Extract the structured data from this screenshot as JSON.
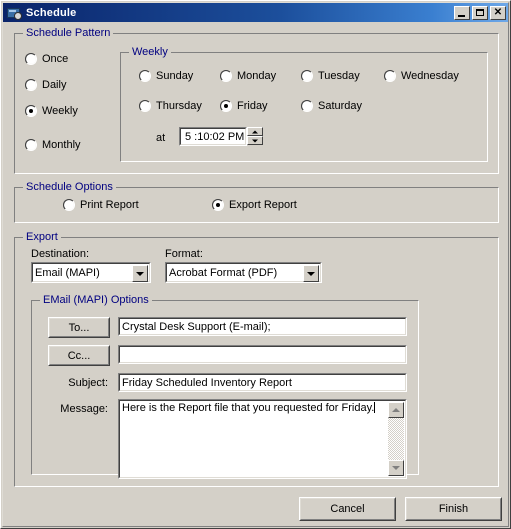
{
  "window": {
    "title": "Schedule",
    "icon": "schedule-app-icon",
    "controls": {
      "minimize": "_",
      "maximize": "□",
      "close": "✕"
    }
  },
  "schedule_pattern": {
    "legend": "Schedule Pattern",
    "options": [
      {
        "label": "Once",
        "checked": false
      },
      {
        "label": "Daily",
        "checked": false
      },
      {
        "label": "Weekly",
        "checked": true
      },
      {
        "label": "Monthly",
        "checked": false
      }
    ],
    "weekly": {
      "legend": "Weekly",
      "days": [
        {
          "label": "Sunday",
          "checked": false
        },
        {
          "label": "Monday",
          "checked": false
        },
        {
          "label": "Tuesday",
          "checked": false
        },
        {
          "label": "Wednesday",
          "checked": false
        },
        {
          "label": "Thursday",
          "checked": false
        },
        {
          "label": "Friday",
          "checked": true
        },
        {
          "label": "Saturday",
          "checked": false
        }
      ],
      "at_label": "at",
      "time_value": "5 :10:02 PM"
    }
  },
  "schedule_options": {
    "legend": "Schedule Options",
    "options": [
      {
        "label": "Print Report",
        "checked": false
      },
      {
        "label": "Export Report",
        "checked": true
      }
    ]
  },
  "export": {
    "legend": "Export",
    "destination_label": "Destination:",
    "destination_value": "Email (MAPI)",
    "format_label": "Format:",
    "format_value": "Acrobat Format (PDF)",
    "email_options": {
      "legend": "EMail (MAPI) Options",
      "to_button": "To...",
      "to_value": "Crystal Desk Support (E-mail);",
      "cc_button": "Cc...",
      "cc_value": "",
      "subject_label": "Subject:",
      "subject_value": "Friday Scheduled Inventory Report",
      "message_label": "Message:",
      "message_value": "Here is the Report file that you requested for Friday."
    }
  },
  "footer": {
    "cancel_label": "Cancel",
    "finish_label": "Finish"
  },
  "colors": {
    "face": "#d4d0c8",
    "group_label": "#000080",
    "title_start": "#0a246a",
    "title_end": "#6ea8e8"
  }
}
